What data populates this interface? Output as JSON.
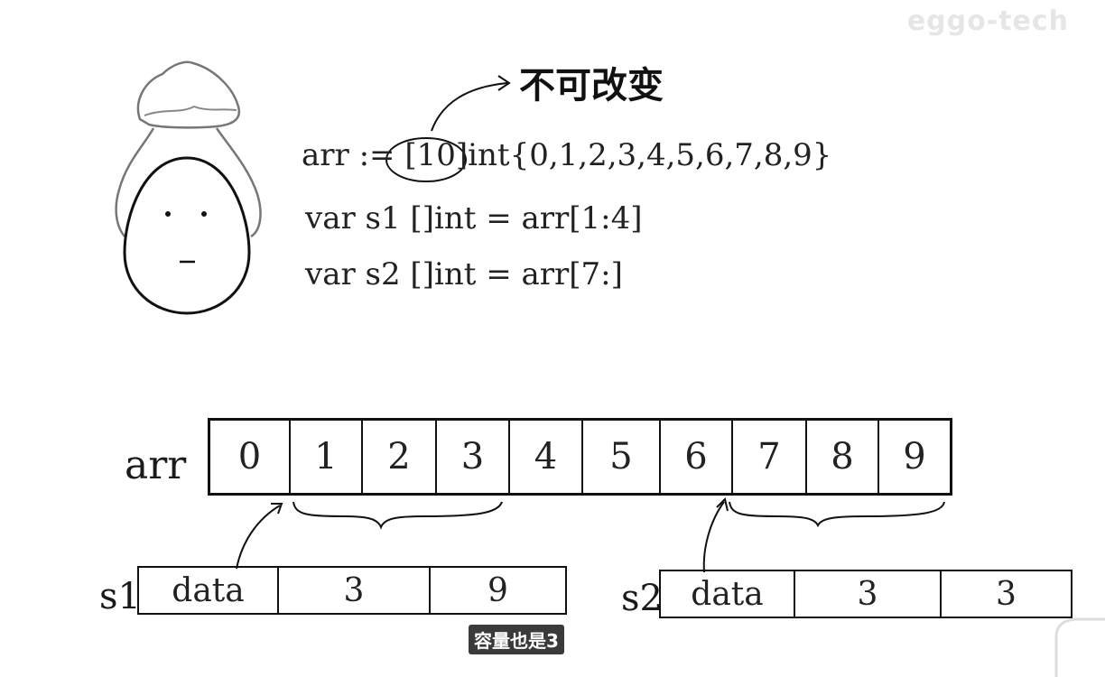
{
  "watermark": "eggo-tech",
  "note_label": "不可改变",
  "code": {
    "line1_prefix": "arr := ",
    "line1_size": "[10]",
    "line1_suffix": "int{0,1,2,3,4,5,6,7,8,9}",
    "line2": "var s1 []int = arr[1:4]",
    "line3": "var s2 []int = arr[7:]"
  },
  "array": {
    "label": "arr",
    "cells": [
      "0",
      "1",
      "2",
      "3",
      "4",
      "5",
      "6",
      "7",
      "8",
      "9"
    ]
  },
  "s1": {
    "label": "s1",
    "fields": [
      "data",
      "3",
      "9"
    ]
  },
  "s2": {
    "label": "s2",
    "fields": [
      "data",
      "3",
      "3"
    ]
  },
  "caption": "容量也是3"
}
